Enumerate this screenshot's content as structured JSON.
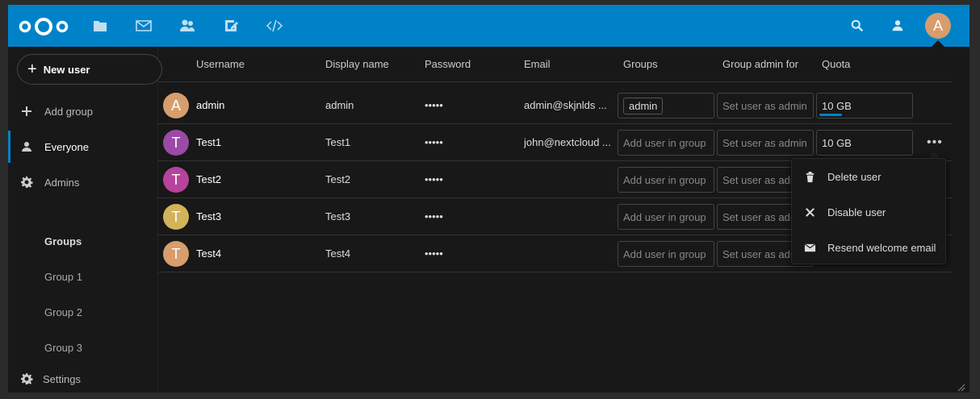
{
  "header": {
    "user_initial": "A",
    "apps": [
      "files-icon",
      "mail-icon",
      "contacts-icon",
      "notes-icon",
      "code-icon"
    ],
    "accent": "#0082c9"
  },
  "sidebar": {
    "new_user_label": "New user",
    "add_group_label": "Add group",
    "everyone_label": "Everyone",
    "admins_label": "Admins",
    "groups_heading": "Groups",
    "groups": [
      "Group 1",
      "Group 2",
      "Group 3"
    ],
    "settings_label": "Settings"
  },
  "table": {
    "columns": [
      "Username",
      "Display name",
      "Password",
      "Email",
      "Groups",
      "Group admin for",
      "Quota"
    ],
    "rows": [
      {
        "initial": "A",
        "color": "#d89d6c",
        "username": "admin",
        "display": "admin",
        "password": "•••••",
        "email": "admin@skjnlds ...",
        "group": "admin",
        "admin_placeholder": "Set user as admin",
        "quota": "10 GB"
      },
      {
        "initial": "T",
        "color": "#9b4aa6",
        "username": "Test1",
        "display": "Test1",
        "password": "•••••",
        "email": "john@nextcloud ...",
        "group_placeholder": "Add user in group",
        "admin_placeholder": "Set user as admin",
        "quota": "10 GB"
      },
      {
        "initial": "T",
        "color": "#b6439c",
        "username": "Test2",
        "display": "Test2",
        "password": "•••••",
        "email": "",
        "group_placeholder": "Add user in group",
        "admin_placeholder": "Set user as adm"
      },
      {
        "initial": "T",
        "color": "#d2b35a",
        "username": "Test3",
        "display": "Test3",
        "password": "•••••",
        "email": "",
        "group_placeholder": "Add user in group",
        "admin_placeholder": "Set user as adm"
      },
      {
        "initial": "T",
        "color": "#d89d6c",
        "username": "Test4",
        "display": "Test4",
        "password": "•••••",
        "email": "",
        "group_placeholder": "Add user in group",
        "admin_placeholder": "Set user as adm"
      }
    ],
    "more_label": "•••"
  },
  "menu": {
    "delete_label": "Delete user",
    "disable_label": "Disable user",
    "resend_label": "Resend welcome email"
  }
}
